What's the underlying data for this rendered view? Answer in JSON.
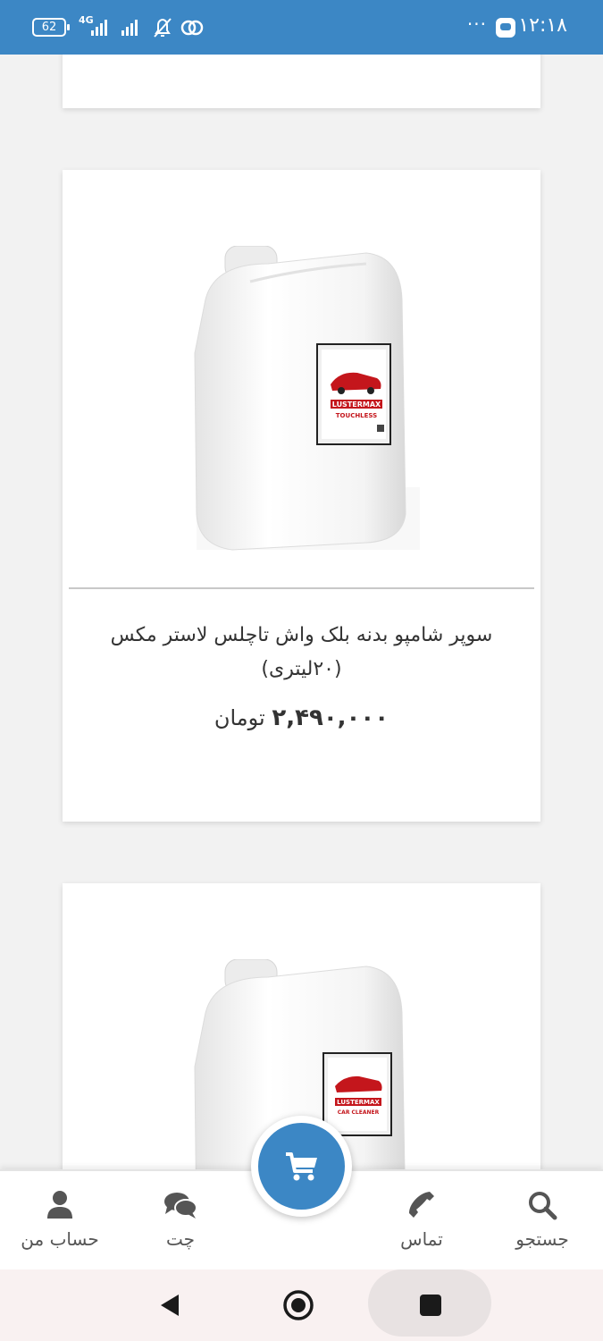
{
  "status_bar": {
    "time": "۱۲:۱۸",
    "dots": "···",
    "battery": "62",
    "network": "4G"
  },
  "product": {
    "title": "سوپر شامپو بدنه بلک واش تاچلس لاستر مکس (۲۰لیتری)",
    "price_amount": "۲,۴۹۰,۰۰۰",
    "price_currency": "تومان",
    "label_brand": "LUSTERMAX",
    "label_line": "TOUCHLESS"
  },
  "next_product": {
    "label_brand": "LUSTERMAX",
    "label_line": "CAR CLEANER"
  },
  "bottom_nav": {
    "items": [
      {
        "label": "جستجو",
        "icon": "search-icon"
      },
      {
        "label": "تماس",
        "icon": "phone-icon"
      },
      {
        "label": "چت",
        "icon": "chat-icon"
      },
      {
        "label": "حساب من",
        "icon": "user-icon"
      }
    ],
    "cart_icon": "cart-icon"
  },
  "colors": {
    "primary": "#3c87c5",
    "text": "#333333"
  }
}
